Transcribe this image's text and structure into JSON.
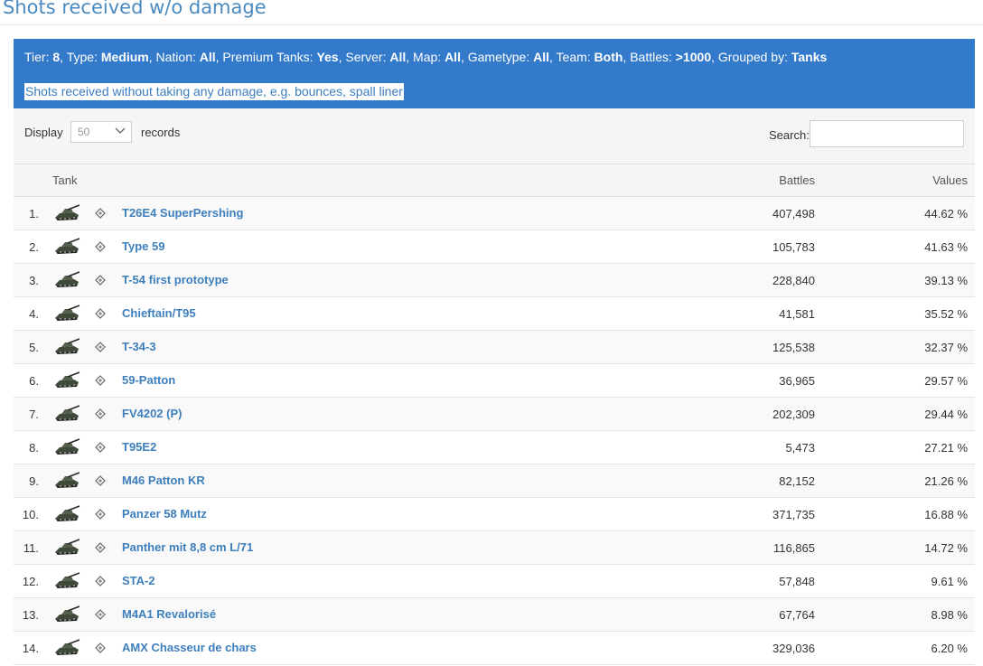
{
  "page_title": "Shots received w/o damage",
  "filters": [
    {
      "label": "Tier: ",
      "value": "8"
    },
    {
      "label": ", Type: ",
      "value": "Medium"
    },
    {
      "label": ", Nation: ",
      "value": "All"
    },
    {
      "label": ", Premium Tanks: ",
      "value": "Yes"
    },
    {
      "label": ", Server: ",
      "value": "All"
    },
    {
      "label": ", Map: ",
      "value": "All"
    },
    {
      "label": ", Gametype: ",
      "value": "All"
    },
    {
      "label": ", Team: ",
      "value": "Both"
    },
    {
      "label": ", Battles: ",
      "value": ">1000"
    },
    {
      "label": ", Grouped by: ",
      "value": "Tanks"
    }
  ],
  "description": "Shots received without taking any damage, e.g. bounces, spall liner",
  "controls": {
    "display_label": "Display",
    "page_length": "50",
    "records_label": "records",
    "search_label": "Search:"
  },
  "columns": {
    "tank": "Tank",
    "battles": "Battles",
    "values": "Values"
  },
  "colors": {
    "panel": "#337acb",
    "link": "#3d7fbd",
    "title": "#4a8ac0"
  },
  "icons": {
    "tank": "tank-icon",
    "nation": "nation-flag-icon",
    "dropdown": "chevron-down-icon"
  },
  "rows": [
    {
      "rank": "1.",
      "name": "T26E4 SuperPershing",
      "battles": "407,498",
      "value": "44.62 %"
    },
    {
      "rank": "2.",
      "name": "Type 59",
      "battles": "105,783",
      "value": "41.63 %"
    },
    {
      "rank": "3.",
      "name": "T-54 first prototype",
      "battles": "228,840",
      "value": "39.13 %"
    },
    {
      "rank": "4.",
      "name": "Chieftain/T95",
      "battles": "41,581",
      "value": "35.52 %"
    },
    {
      "rank": "5.",
      "name": "T-34-3",
      "battles": "125,538",
      "value": "32.37 %"
    },
    {
      "rank": "6.",
      "name": "59-Patton",
      "battles": "36,965",
      "value": "29.57 %"
    },
    {
      "rank": "7.",
      "name": "FV4202 (P)",
      "battles": "202,309",
      "value": "29.44 %"
    },
    {
      "rank": "8.",
      "name": "T95E2",
      "battles": "5,473",
      "value": "27.21 %"
    },
    {
      "rank": "9.",
      "name": "M46 Patton KR",
      "battles": "82,152",
      "value": "21.26 %"
    },
    {
      "rank": "10.",
      "name": "Panzer 58 Mutz",
      "battles": "371,735",
      "value": "16.88 %"
    },
    {
      "rank": "11.",
      "name": "Panther mit 8,8 cm L/71",
      "battles": "116,865",
      "value": "14.72 %"
    },
    {
      "rank": "12.",
      "name": "STA-2",
      "battles": "57,848",
      "value": "9.61 %"
    },
    {
      "rank": "13.",
      "name": "M4A1 Revalorisé",
      "battles": "67,764",
      "value": "8.98 %"
    },
    {
      "rank": "14.",
      "name": "AMX Chasseur de chars",
      "battles": "329,036",
      "value": "6.20 %"
    }
  ]
}
